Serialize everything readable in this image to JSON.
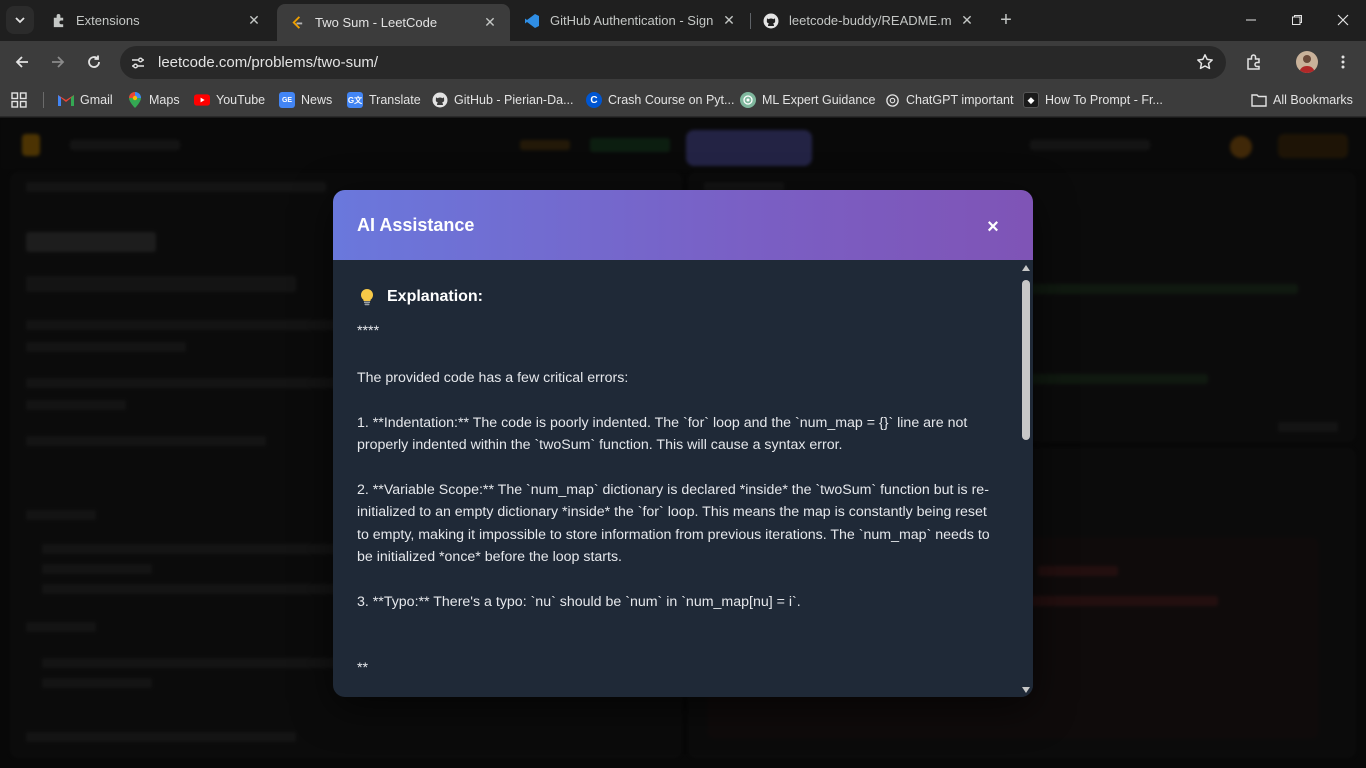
{
  "tabs": [
    {
      "title": "Extensions",
      "icon": "puzzle-icon",
      "active": false
    },
    {
      "title": "Two Sum - LeetCode",
      "icon": "leetcode-icon",
      "active": true
    },
    {
      "title": "GitHub Authentication - Sign In",
      "icon": "vscode-icon",
      "active": false
    },
    {
      "title": "leetcode-buddy/README.md at",
      "icon": "github-icon",
      "active": false
    }
  ],
  "address_bar": {
    "url": "leetcode.com/problems/two-sum/"
  },
  "bookmarks": {
    "items": [
      {
        "label": "Gmail",
        "icon": "gmail-icon"
      },
      {
        "label": "Maps",
        "icon": "maps-icon"
      },
      {
        "label": "YouTube",
        "icon": "youtube-icon"
      },
      {
        "label": "News",
        "icon": "news-icon"
      },
      {
        "label": "Translate",
        "icon": "translate-icon"
      },
      {
        "label": "GitHub - Pierian-Da...",
        "icon": "github-icon"
      },
      {
        "label": "Crash Course on Pyt...",
        "icon": "coursera-icon"
      },
      {
        "label": "ML Expert Guidance",
        "icon": "chatgpt-icon"
      },
      {
        "label": "ChatGPT important",
        "icon": "chatgpt-icon"
      },
      {
        "label": "How To Prompt - Fr...",
        "icon": "prompt-icon"
      }
    ],
    "all_bookmarks": "All Bookmarks"
  },
  "modal": {
    "title": "AI Assistance",
    "close_label": "×",
    "heading": "Explanation:",
    "paragraphs": [
      "****",
      "The provided code has a few critical errors:",
      "1. **Indentation:** The code is poorly indented.  The `for` loop and the `num_map = {}` line are not properly indented within the `twoSum` function.  This will cause a syntax error.",
      "2. **Variable Scope:** The `num_map` dictionary is declared *inside* the `twoSum` function but is re-initialized to an empty dictionary *inside* the `for` loop.  This means the map is constantly being reset to empty, making it impossible to store information from previous iterations.  The `num_map` needs to be initialized *once* before the loop starts.",
      "3. **Typo:** There's a typo: `nu` should be `num` in `num_map[nu] = i`.",
      "",
      "**"
    ]
  }
}
